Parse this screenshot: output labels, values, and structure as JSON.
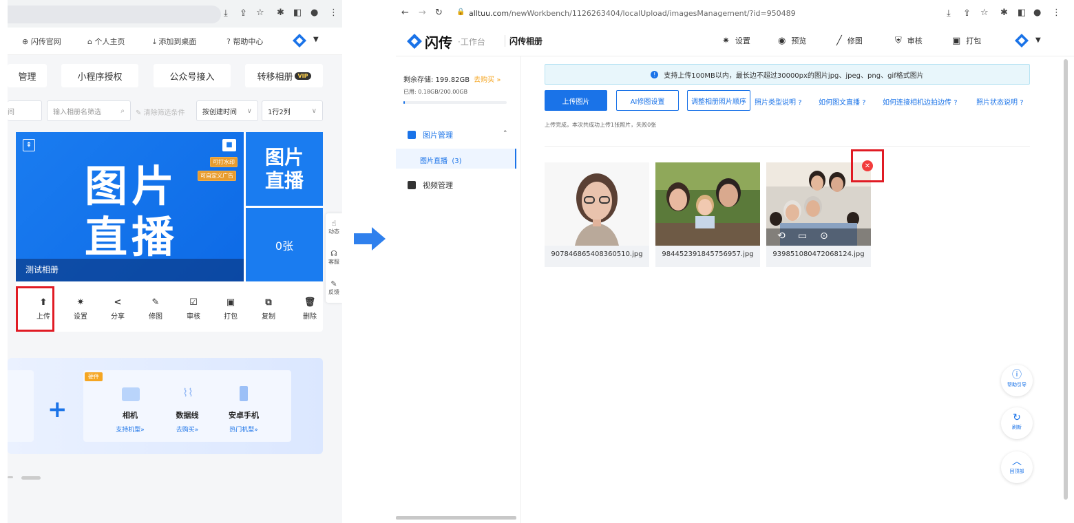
{
  "left": {
    "top_nav": [
      "闪传官网",
      "个人主页",
      "添加到桌面",
      "帮助中心"
    ],
    "tabs": [
      "管理",
      "小程序授权",
      "公众号接入",
      "转移相册"
    ],
    "vip": "VIP",
    "filters": {
      "partial": "间",
      "album_search_placeholder": "输入相册名筛选",
      "clear_filters": "清除筛选条件",
      "sort": "按创建时间",
      "layout": "1行2列"
    },
    "album": {
      "title_line1": "图片",
      "title_line2": "直播",
      "name": "测试相册",
      "tag_watermark": "可打水印",
      "tag_ads": "可自定义广告",
      "side_title_line1": "图片",
      "side_title_line2": "直播",
      "count": "0张"
    },
    "actions": [
      "上传",
      "设置",
      "分享",
      "修图",
      "审核",
      "打包",
      "复制",
      "删除"
    ],
    "side_float": [
      "动态",
      "客服",
      "反馈"
    ],
    "promo": {
      "badge": "硬件",
      "items": [
        {
          "name": "相机",
          "link": "支持机型»"
        },
        {
          "name": "数据线",
          "link": "去购买»"
        },
        {
          "name": "安卓手机",
          "link": "热门机型»"
        }
      ]
    }
  },
  "right": {
    "url_host": "alltuu.com",
    "url_path": "/newWorkbench/1126263404/localUpload/imagesManagement/?id=950489",
    "logo": "闪传",
    "logo_sub": "·工作台",
    "app_name": "闪传相册",
    "top_actions": [
      "设置",
      "预览",
      "修图",
      "审核",
      "打包"
    ],
    "storage_label": "剩余存储: 199.82GB",
    "buy_link": "去购买 »",
    "used_label": "已用: 0.18GB/200.00GB",
    "used_fraction": 0.0009,
    "menu": {
      "image_mgmt": "图片管理",
      "image_live": "图片直播",
      "image_live_count": "(3)",
      "video_mgmt": "视频管理"
    },
    "notice": "支持上传100MB以内，最长边不超过30000px的图片jpg、jpeg、png、gif格式图片",
    "buttons": {
      "upload": "上传图片",
      "ai": "AI修图设置",
      "reorder": "调整相册照片顺序"
    },
    "help_links": [
      "照片类型说明",
      "如何图文直播",
      "如何连接相机边拍边传",
      "照片状态说明"
    ],
    "upload_status": "上传完成，本次共成功上传1张照片，失败0张",
    "photos": [
      "907846865408360510.jpg",
      "984452391845756957.jpg",
      "939851080472068124.jpg"
    ],
    "float_buttons": [
      "帮助引导",
      "刷新",
      "回顶部"
    ]
  }
}
